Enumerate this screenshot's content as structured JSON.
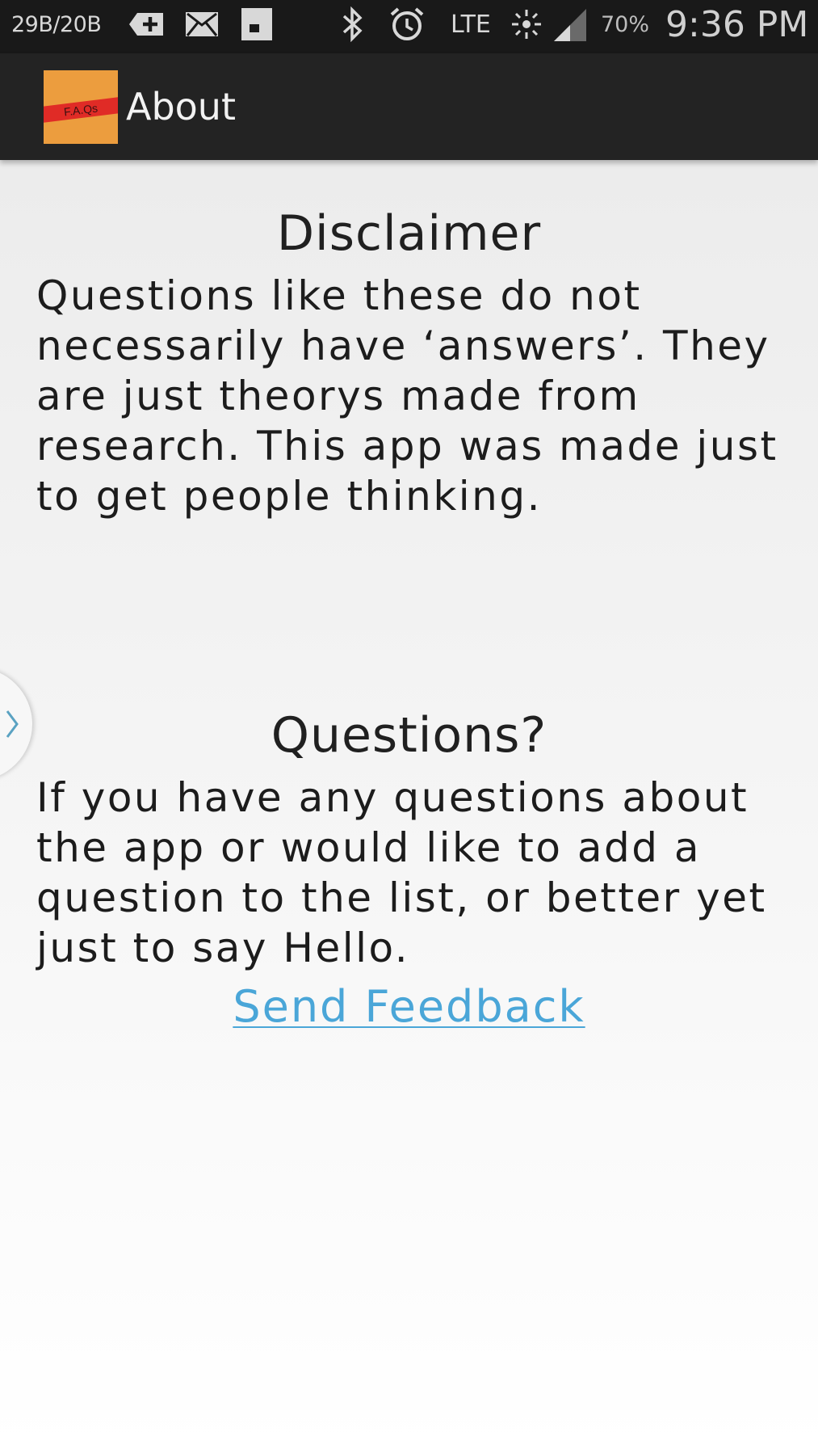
{
  "status_bar": {
    "data_rate": "29B/20B",
    "network": "LTE",
    "battery": "70%",
    "time": "9:36 PM",
    "icons": [
      "add-icon",
      "mail-icon",
      "sim-card-icon",
      "bluetooth-icon",
      "alarm-icon",
      "data-activity-icon",
      "signal-icon"
    ]
  },
  "action_bar": {
    "logo_text": "F.A.Qs",
    "title": "About"
  },
  "disclaimer": {
    "heading": "Disclaimer",
    "body": "Questions like these do not necessarily have ‘answers’. They are just theorys made from research. This app was made just to get people thinking."
  },
  "questions": {
    "heading": "Questions?",
    "body": "If you have any questions about the app or would like to add a question to the list, or better yet just to say Hello.",
    "link_label": "Send Feedback"
  },
  "colors": {
    "status_bar_bg": "#191919",
    "action_bar_bg": "#232323",
    "logo_orange": "#ec9d3e",
    "logo_red": "#e02b26",
    "link_blue": "#4aa6d8"
  }
}
